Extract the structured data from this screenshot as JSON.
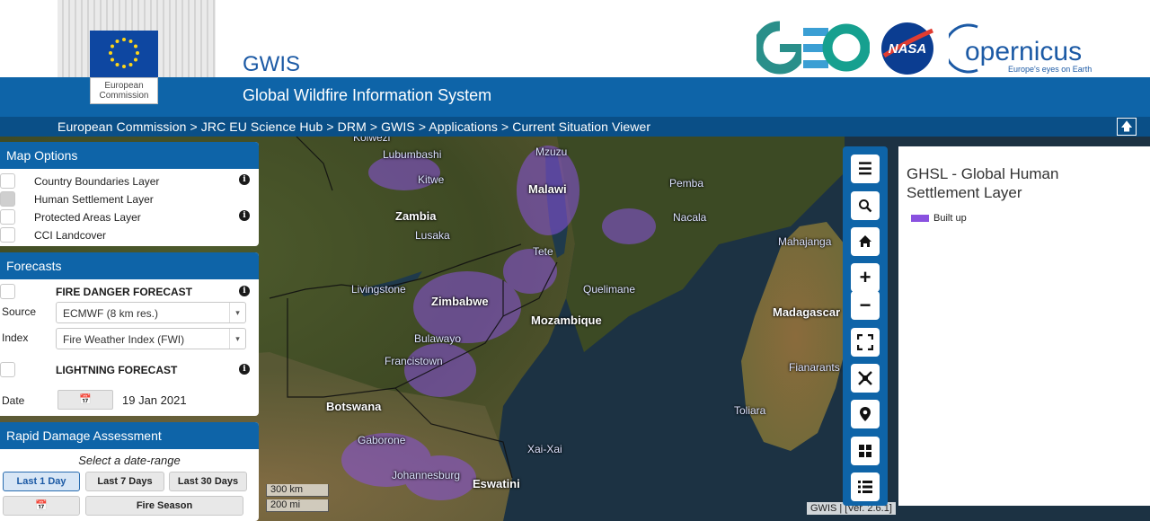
{
  "header": {
    "app_title": "GWIS",
    "app_subtitle": "Global Wildfire Information System",
    "ec_logo_text": "European\nCommission",
    "breadcrumb": "European Commission > JRC EU Science Hub > DRM > GWIS > Applications > Current Situation Viewer",
    "partner_logos": [
      "GEO",
      "NASA",
      "Copernicus"
    ],
    "copernicus_text": "opernicus",
    "copernicus_tagline": "Europe's eyes on Earth",
    "nasa_text": "NASA",
    "to_top_icon": "arrow-up-icon"
  },
  "map_options": {
    "title": "Map Options",
    "layers": [
      {
        "label": "Country Boundaries Layer",
        "checked": false,
        "info": true
      },
      {
        "label": "Human Settlement Layer",
        "checked": true,
        "info": false
      },
      {
        "label": "Protected Areas Layer",
        "checked": false,
        "info": true
      },
      {
        "label": "CCI Landcover",
        "checked": false,
        "info": false
      }
    ]
  },
  "forecasts": {
    "title": "Forecasts",
    "fire_danger_title": "FIRE DANGER FORECAST",
    "source_label": "Source",
    "source_value": "ECMWF (8 km res.)",
    "index_label": "Index",
    "index_value": "Fire Weather Index (FWI)",
    "lightning_title": "LIGHTNING FORECAST",
    "date_label": "Date",
    "date_value": "19 Jan 2021"
  },
  "rapid_damage": {
    "title": "Rapid Damage Assessment",
    "prompt": "Select a date-range",
    "buttons": [
      "Last 1 Day",
      "Last 7 Days",
      "Last 30 Days"
    ],
    "active_button": "Last 1 Day",
    "season_button": "Fire Season"
  },
  "map": {
    "labels": {
      "lubumbashi": "Lubumbashi",
      "kitwe": "Kitwe",
      "zambia": "Zambia",
      "lusaka": "Lusaka",
      "mzuzu": "Mzuzu",
      "malawi": "Malawi",
      "pemba": "Pemba",
      "nacala": "Nacala",
      "tete": "Tete",
      "quelimane": "Quelimane",
      "mahajanga": "Mahajanga",
      "livingstone": "Livingstone",
      "zimbabwe": "Zimbabwe",
      "mozambique": "Mozambique",
      "madagascar": "Madagascar",
      "bulawayo": "Bulawayo",
      "francistown": "Francistown",
      "fianarantsoa": "Fianarants",
      "botswana": "Botswana",
      "toliara": "Toliara",
      "gaborone": "Gaborone",
      "xaixai": "Xai-Xai",
      "johannesburg": "Johannesburg",
      "eswatini": "Eswatini",
      "kolwezi": "Kolwezi"
    },
    "scale_km": "300 km",
    "scale_mi": "200 mi",
    "version": "GWIS | [Ver. 2.6.1]"
  },
  "toolbar": {
    "tools": [
      "menu-icon",
      "search-icon",
      "home-icon",
      "zoom-in-icon",
      "zoom-out-icon",
      "fullscreen-icon",
      "zoom-extent-icon",
      "location-pin-icon",
      "grid-icon",
      "list-icon"
    ]
  },
  "legend": {
    "title": "GHSL - Global Human Settlement Layer",
    "item_label": "Built up",
    "item_color": "#8a52e0"
  }
}
